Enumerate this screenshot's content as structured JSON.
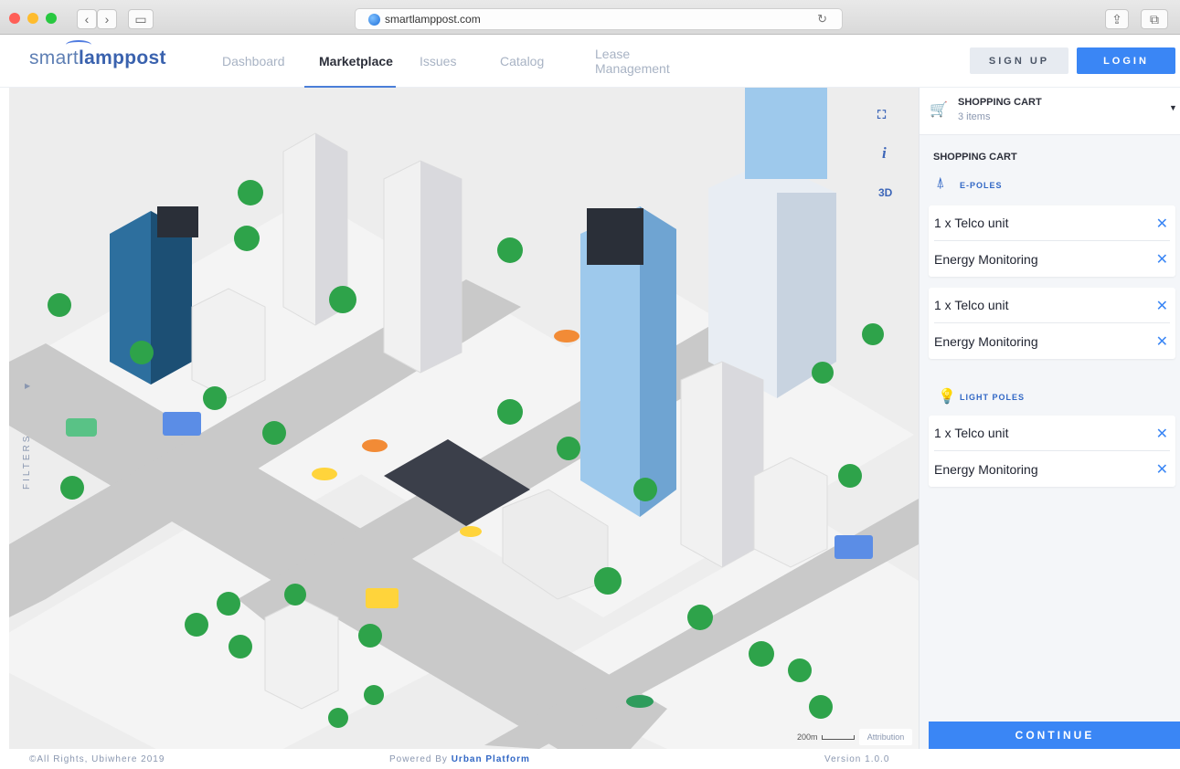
{
  "browser": {
    "url": "smartlamppost.com",
    "back_icon": "chevron-left-icon",
    "forward_icon": "chevron-right-icon",
    "sidebar_icon": "sidebar-icon",
    "reload_icon": "reload-icon",
    "share_icon": "share-icon",
    "tabs_icon": "tabs-icon"
  },
  "header": {
    "logo_light": "smart",
    "logo_bold": "lamppost",
    "nav": [
      {
        "label": "Dashboard",
        "active": false
      },
      {
        "label": "Marketplace",
        "active": true
      },
      {
        "label": "Issues",
        "active": false
      },
      {
        "label": "Catalog",
        "active": false
      },
      {
        "label": "Lease Management",
        "active": false
      }
    ],
    "signup_label": "SIGN UP",
    "login_label": "LOGIN",
    "accent_color": "#3a86f5"
  },
  "map": {
    "filters_label": "FILTERS",
    "fullscreen_icon": "fullscreen-icon",
    "info_label": "i",
    "view_3d_label": "3D",
    "scale_label": "200m",
    "attribution_label": "Attribution"
  },
  "cart": {
    "title": "SHOPPING CART",
    "count": "3 items",
    "section_title": "SHOPPING CART",
    "groups": [
      {
        "title": "E-POLES",
        "icon": "pylon-icon",
        "cards": [
          {
            "items": [
              "1 x Telco unit",
              "Energy Monitoring"
            ]
          },
          {
            "items": [
              "1 x Telco unit",
              "Energy Monitoring"
            ]
          }
        ]
      },
      {
        "title": "LIGHT POLES",
        "icon": "bulb-icon",
        "cards": [
          {
            "items": [
              "1 x Telco unit",
              "Energy Monitoring"
            ]
          }
        ]
      }
    ],
    "remove_glyph": "✕",
    "continue_label": "CONTINUE"
  },
  "footer": {
    "copyright": "©All Rights, Ubiwhere 2019",
    "powered_prefix": "Powered By",
    "powered_brand": "Urban Platform",
    "version": "Version 1.0.0"
  }
}
